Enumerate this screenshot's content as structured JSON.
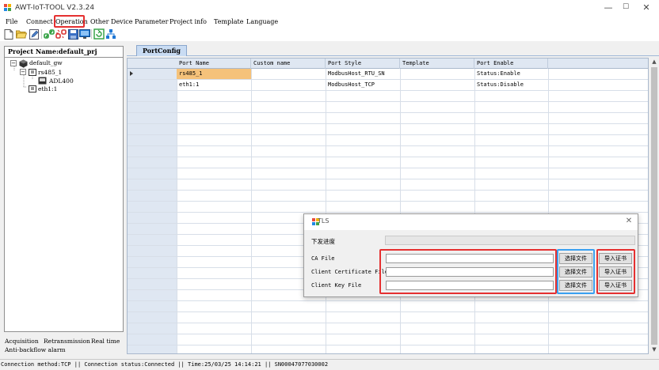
{
  "window": {
    "title": "AWT-IoT-TOOL V2.3.24",
    "minimize": "—",
    "maximize": "☐",
    "close": "✕"
  },
  "menu": [
    "File",
    "Connect",
    "Operation",
    "Other Device",
    "Parameter",
    "Project info",
    "Template",
    "Language"
  ],
  "highlighted_menu": "Operation",
  "toolbar_icons": [
    "new-file-icon",
    "open-folder-icon",
    "edit-icon",
    "connect-icon",
    "disconnect-icon",
    "save-icon",
    "monitor-icon",
    "refresh-icon",
    "network-icon"
  ],
  "project": {
    "header": "Project Name:default_prj",
    "tree": {
      "root": "default_gw",
      "port1": "rs485_1",
      "device": "ADL400",
      "port2": "eth1:1"
    }
  },
  "left_tabs": [
    "Acquisition",
    "Retransmission",
    "Real time",
    "Anti-backflow alarm"
  ],
  "tab": "PortConfig",
  "grid": {
    "columns": [
      "Port Name",
      "Custom name",
      "Port Style",
      "Template",
      "Port Enable"
    ],
    "rows": [
      [
        "rs485_1",
        "",
        "ModbusHost_RTU_SN",
        "",
        "Status:Enable"
      ],
      [
        "eth1:1",
        "",
        "ModbusHost_TCP",
        "",
        "Status:Disable"
      ]
    ]
  },
  "dialog": {
    "title": "TLS",
    "progress_label": "下发进度",
    "close": "✕",
    "fields": [
      {
        "label": "CA File",
        "value": "",
        "browse": "选择文件",
        "import": "导入证书"
      },
      {
        "label": "Client Certificate File",
        "value": "",
        "browse": "选择文件",
        "import": "导入证书"
      },
      {
        "label": "Client Key File",
        "value": "",
        "browse": "选择文件",
        "import": "导入证书"
      }
    ]
  },
  "status": {
    "connection_method": "Connection method:TCP",
    "connection_status": "Connection status:Connected",
    "time": "Time:25/03/25 14:14:21",
    "serial": "SN00047077030002",
    "separator": " || "
  },
  "colors": {
    "highlight_red": "#e53030",
    "highlight_blue": "#3aa0f0",
    "selected_cell": "#f5c27a",
    "grid_header": "#dfe7f2",
    "tab_active": "#c9dcf3"
  }
}
